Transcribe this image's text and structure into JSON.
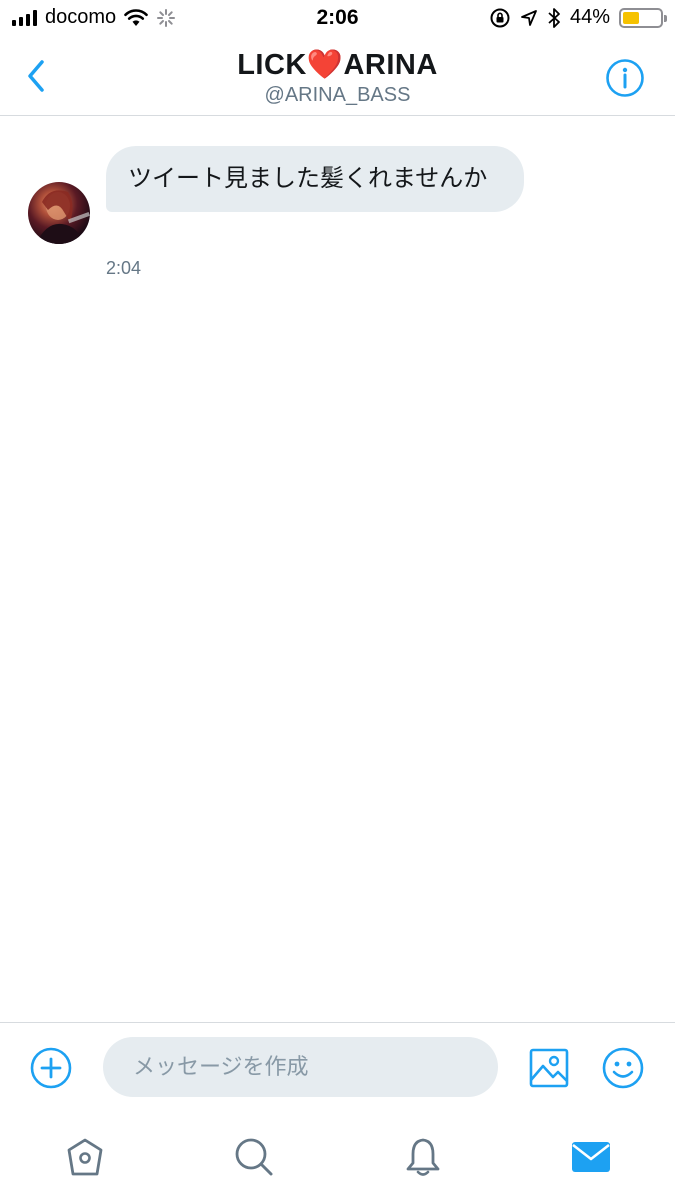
{
  "status_bar": {
    "carrier": "docomo",
    "time": "2:06",
    "battery_percent": "44%",
    "battery_level": 0.44,
    "icons": [
      "signal-icon",
      "wifi-icon",
      "activity-spinner-icon",
      "orientation-lock-icon",
      "location-arrow-icon",
      "bluetooth-icon",
      "battery-icon"
    ]
  },
  "header": {
    "title": "LICK❤️ARINA",
    "handle": "@ARINA_BASS",
    "back_icon": "chevron-left-icon",
    "info_icon": "info-icon"
  },
  "conversation": {
    "messages": [
      {
        "text": "ツイート見ました髪くれませんか",
        "time": "2:04"
      }
    ]
  },
  "composer": {
    "placeholder": "メッセージを作成",
    "value": "",
    "icons": [
      "add-circle-icon",
      "image-icon",
      "emoji-icon"
    ]
  },
  "tab_bar": {
    "tabs": [
      "home-icon",
      "search-icon",
      "notifications-icon",
      "messages-icon"
    ],
    "active": "messages-icon"
  },
  "colors": {
    "accent": "#1da1f2",
    "bubble": "#e6ecf0",
    "secondary_text": "#657786",
    "battery": "#f6c200"
  }
}
